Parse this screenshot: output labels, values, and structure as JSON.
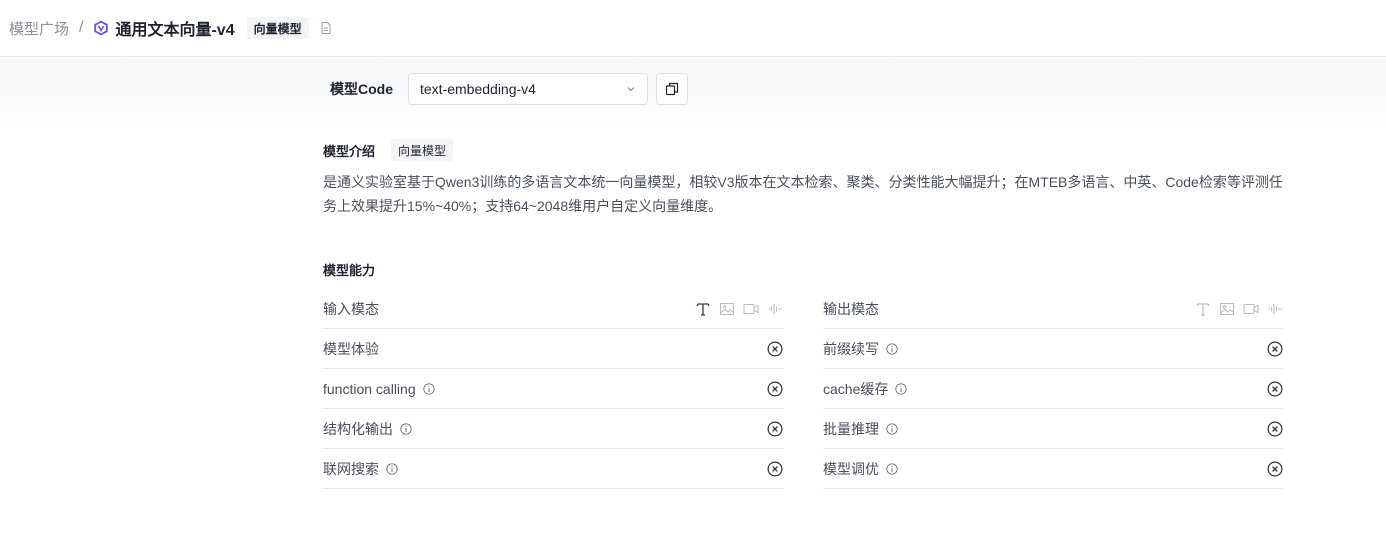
{
  "breadcrumb": {
    "root": "模型广场",
    "separator": "/",
    "title": "通用文本向量-v4",
    "tag": "向量模型"
  },
  "model_code": {
    "label": "模型Code",
    "selected": "text-embedding-v4"
  },
  "intro": {
    "title": "模型介绍",
    "tag": "向量模型",
    "text": "是通义实验室基于Qwen3训练的多语言文本统一向量模型，相较V3版本在文本检索、聚类、分类性能大幅提升；在MTEB多语言、中英、Code检索等评测任务上效果提升15%~40%；支持64~2048维用户自定义向量维度。"
  },
  "capabilities": {
    "title": "模型能力",
    "input_modality": {
      "label": "输入模态",
      "icons": [
        {
          "name": "text-icon",
          "active": true
        },
        {
          "name": "image-icon",
          "active": false
        },
        {
          "name": "video-icon",
          "active": false
        },
        {
          "name": "audio-icon",
          "active": false
        }
      ]
    },
    "output_modality": {
      "label": "输出模态",
      "icons": [
        {
          "name": "text-icon",
          "active": false
        },
        {
          "name": "image-icon",
          "active": false
        },
        {
          "name": "video-icon",
          "active": false
        },
        {
          "name": "audio-icon",
          "active": false
        }
      ]
    },
    "left": [
      {
        "label": "模型体验",
        "info": false,
        "supported": false
      },
      {
        "label": "function calling",
        "info": true,
        "supported": false
      },
      {
        "label": "结构化输出",
        "info": true,
        "supported": false
      },
      {
        "label": "联网搜索",
        "info": true,
        "supported": false
      }
    ],
    "right": [
      {
        "label": "前缀续写",
        "info": true,
        "supported": false
      },
      {
        "label": "cache缓存",
        "info": true,
        "supported": false
      },
      {
        "label": "批量推理",
        "info": true,
        "supported": false
      },
      {
        "label": "模型调优",
        "info": true,
        "supported": false
      }
    ]
  },
  "colors": {
    "active_icon": "#3a3f4c",
    "inactive_icon": "#b8bcc5",
    "logo": "#6b4cf6"
  }
}
